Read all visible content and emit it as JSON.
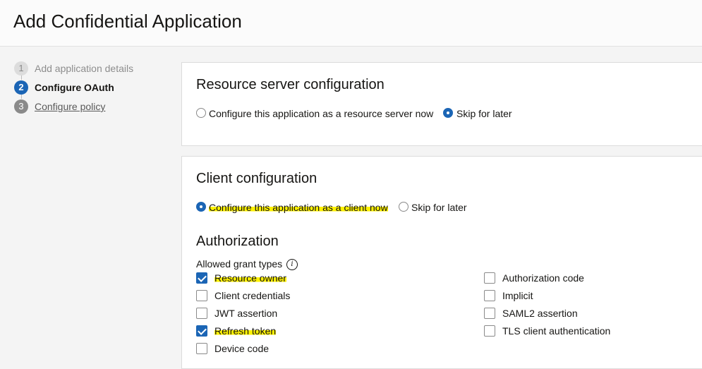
{
  "page": {
    "title": "Add Confidential Application"
  },
  "steps": [
    {
      "num": "1",
      "label": "Add application details",
      "state": "done"
    },
    {
      "num": "2",
      "label": "Configure OAuth",
      "state": "active"
    },
    {
      "num": "3",
      "label": "Configure policy",
      "state": "todo"
    }
  ],
  "resource_server": {
    "title": "Resource server configuration",
    "option_now": "Configure this application as a resource server now",
    "option_later": "Skip for later",
    "selected": "later"
  },
  "client": {
    "title": "Client configuration",
    "option_now": "Configure this application as a client now",
    "option_later": "Skip for later",
    "selected": "now",
    "authorization": {
      "title": "Authorization",
      "grant_types_label": "Allowed grant types",
      "info_icon": "info-icon",
      "left": [
        {
          "label": "Resource owner",
          "checked": true
        },
        {
          "label": "Client credentials",
          "checked": false
        },
        {
          "label": "JWT assertion",
          "checked": false
        },
        {
          "label": "Refresh token",
          "checked": true
        },
        {
          "label": "Device code",
          "checked": false
        }
      ],
      "right": [
        {
          "label": "Authorization code",
          "checked": false
        },
        {
          "label": "Implicit",
          "checked": false
        },
        {
          "label": "SAML2 assertion",
          "checked": false
        },
        {
          "label": "TLS client authentication",
          "checked": false
        }
      ]
    }
  },
  "colors": {
    "accent": "#1b65b5",
    "highlight": "#fff200"
  }
}
